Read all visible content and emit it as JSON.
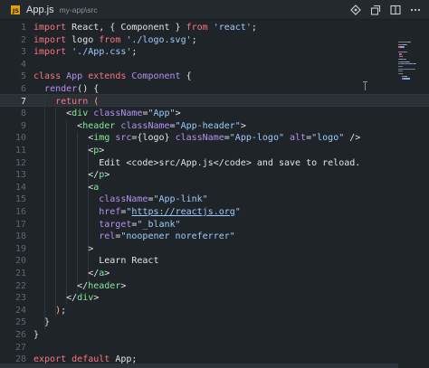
{
  "tab": {
    "file_badge": "JS",
    "title": "App.js",
    "path": "my-app\\src"
  },
  "actions": [
    {
      "icon": "git-branch-icon"
    },
    {
      "icon": "split-editor-icon"
    },
    {
      "icon": "open-changes-icon"
    },
    {
      "icon": "more-actions-icon"
    }
  ],
  "editor": {
    "active_line": "7",
    "lines": [
      {
        "n": "1",
        "tokens": [
          [
            "kw",
            "import "
          ],
          [
            "df",
            "React, { Component } "
          ],
          [
            "kw",
            "from "
          ],
          [
            "str",
            "'react'"
          ],
          [
            "df",
            ";"
          ]
        ]
      },
      {
        "n": "2",
        "tokens": [
          [
            "kw",
            "import "
          ],
          [
            "df",
            "logo "
          ],
          [
            "kw",
            "from "
          ],
          [
            "str",
            "'./logo.svg'"
          ],
          [
            "df",
            ";"
          ]
        ]
      },
      {
        "n": "3",
        "tokens": [
          [
            "kw",
            "import "
          ],
          [
            "str",
            "'./App.css'"
          ],
          [
            "df",
            ";"
          ]
        ]
      },
      {
        "n": "4",
        "tokens": []
      },
      {
        "n": "5",
        "tokens": [
          [
            "kw",
            "class "
          ],
          [
            "at",
            "App "
          ],
          [
            "kw",
            "extends "
          ],
          [
            "at",
            "Component "
          ],
          [
            "df",
            "{"
          ]
        ]
      },
      {
        "n": "6",
        "tokens": [
          [
            "df",
            "  "
          ],
          [
            "at",
            "render"
          ],
          [
            "df",
            "() {"
          ]
        ]
      },
      {
        "n": "7",
        "tokens": [
          [
            "df",
            "    "
          ],
          [
            "kw",
            "return "
          ],
          [
            "br",
            "("
          ]
        ]
      },
      {
        "n": "8",
        "tokens": [
          [
            "df",
            "      <"
          ],
          [
            "tg",
            "div "
          ],
          [
            "at",
            "className"
          ],
          [
            "df",
            "="
          ],
          [
            "str",
            "\"App\""
          ],
          [
            "df",
            ">"
          ]
        ]
      },
      {
        "n": "9",
        "tokens": [
          [
            "df",
            "        <"
          ],
          [
            "tg",
            "header "
          ],
          [
            "at",
            "className"
          ],
          [
            "df",
            "="
          ],
          [
            "str",
            "\"App-header\""
          ],
          [
            "df",
            ">"
          ]
        ]
      },
      {
        "n": "10",
        "tokens": [
          [
            "df",
            "          <"
          ],
          [
            "tg",
            "img "
          ],
          [
            "at",
            "src"
          ],
          [
            "df",
            "={logo} "
          ],
          [
            "at",
            "className"
          ],
          [
            "df",
            "="
          ],
          [
            "str",
            "\"App-logo\" "
          ],
          [
            "at",
            "alt"
          ],
          [
            "df",
            "="
          ],
          [
            "str",
            "\"logo\" "
          ],
          [
            "df",
            "/>"
          ]
        ]
      },
      {
        "n": "11",
        "tokens": [
          [
            "df",
            "          <"
          ],
          [
            "tg",
            "p"
          ],
          [
            "df",
            ">"
          ]
        ]
      },
      {
        "n": "12",
        "tokens": [
          [
            "tx",
            "            Edit <"
          ],
          [
            "tx",
            "code"
          ],
          [
            "tx",
            ">src/App.js</"
          ],
          [
            "tx",
            "code"
          ],
          [
            "tx",
            "> and save to reload."
          ]
        ]
      },
      {
        "n": "13",
        "tokens": [
          [
            "df",
            "          </"
          ],
          [
            "tg",
            "p"
          ],
          [
            "df",
            ">"
          ]
        ]
      },
      {
        "n": "14",
        "tokens": [
          [
            "df",
            "          <"
          ],
          [
            "tg",
            "a"
          ]
        ]
      },
      {
        "n": "15",
        "tokens": [
          [
            "df",
            "            "
          ],
          [
            "at",
            "className"
          ],
          [
            "df",
            "="
          ],
          [
            "str",
            "\"App-link\""
          ]
        ]
      },
      {
        "n": "16",
        "tokens": [
          [
            "df",
            "            "
          ],
          [
            "at",
            "href"
          ],
          [
            "df",
            "="
          ],
          [
            "str",
            "\""
          ],
          [
            "url",
            "https://reactjs.org"
          ],
          [
            "str",
            "\""
          ]
        ]
      },
      {
        "n": "17",
        "tokens": [
          [
            "df",
            "            "
          ],
          [
            "at",
            "target"
          ],
          [
            "df",
            "="
          ],
          [
            "str",
            "\"_blank\""
          ]
        ]
      },
      {
        "n": "18",
        "tokens": [
          [
            "df",
            "            "
          ],
          [
            "at",
            "rel"
          ],
          [
            "df",
            "="
          ],
          [
            "str",
            "\"noopener noreferrer\""
          ]
        ]
      },
      {
        "n": "19",
        "tokens": [
          [
            "df",
            "          >"
          ]
        ]
      },
      {
        "n": "20",
        "tokens": [
          [
            "tx",
            "            Learn React"
          ]
        ]
      },
      {
        "n": "21",
        "tokens": [
          [
            "df",
            "          </"
          ],
          [
            "tg",
            "a"
          ],
          [
            "df",
            ">"
          ]
        ]
      },
      {
        "n": "22",
        "tokens": [
          [
            "df",
            "        </"
          ],
          [
            "tg",
            "header"
          ],
          [
            "df",
            ">"
          ]
        ]
      },
      {
        "n": "23",
        "tokens": [
          [
            "df",
            "      </"
          ],
          [
            "tg",
            "div"
          ],
          [
            "df",
            ">"
          ]
        ]
      },
      {
        "n": "24",
        "tokens": [
          [
            "df",
            "    "
          ],
          [
            "br",
            ")"
          ],
          [
            "df",
            ";"
          ]
        ]
      },
      {
        "n": "25",
        "tokens": [
          [
            "df",
            "  }"
          ]
        ]
      },
      {
        "n": "26",
        "tokens": [
          [
            "df",
            "}"
          ]
        ]
      },
      {
        "n": "27",
        "tokens": []
      },
      {
        "n": "28",
        "tokens": [
          [
            "kw",
            "export "
          ],
          [
            "kw",
            "default "
          ],
          [
            "df",
            "App;"
          ]
        ]
      }
    ]
  },
  "colors": {
    "background": "#1f2428",
    "keyword": "#f97583",
    "string": "#9ecbff",
    "tag": "#85e89d",
    "attribute": "#b392f0",
    "bracket": "#ffab70",
    "js_badge": "#e5a00d"
  }
}
